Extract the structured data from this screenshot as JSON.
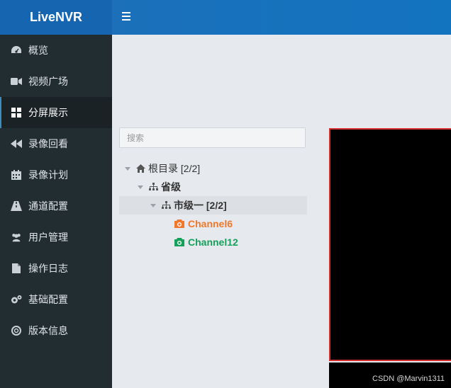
{
  "app": {
    "brand": "LiveNVR"
  },
  "sidebar": {
    "items": [
      {
        "label": "概览",
        "icon": "dashboard-icon"
      },
      {
        "label": "视频广场",
        "icon": "video-camera-icon"
      },
      {
        "label": "分屏展示",
        "icon": "grid-icon",
        "active": true
      },
      {
        "label": "录像回看",
        "icon": "rewind-icon"
      },
      {
        "label": "录像计划",
        "icon": "calendar-icon"
      },
      {
        "label": "通道配置",
        "icon": "road-icon"
      },
      {
        "label": "用户管理",
        "icon": "users-icon"
      },
      {
        "label": "操作日志",
        "icon": "file-icon"
      },
      {
        "label": "基础配置",
        "icon": "gears-icon"
      },
      {
        "label": "版本信息",
        "icon": "lifebuoy-icon"
      }
    ]
  },
  "search": {
    "placeholder": "搜索"
  },
  "tree": {
    "root": {
      "label": "根目录 [2/2]"
    },
    "province": {
      "label": "省级"
    },
    "city": {
      "label": "市级一 [2/2]"
    },
    "channels": [
      {
        "label": "Channel6",
        "color": "#f0782c"
      },
      {
        "label": "Channel12",
        "color": "#16a05a"
      }
    ]
  },
  "watermark": "CSDN @Marvin1311"
}
